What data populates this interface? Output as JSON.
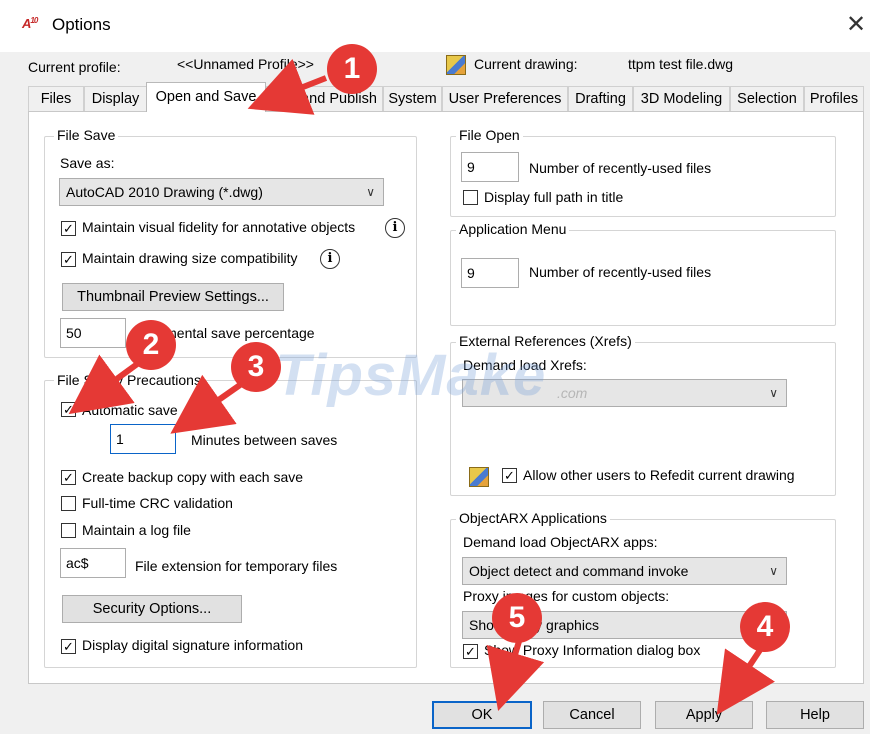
{
  "window": {
    "title": "Options",
    "app_icon": "A",
    "app_icon_sub": "10"
  },
  "profile": {
    "current_profile_label": "Current profile:",
    "current_profile_value": "<<Unnamed Profile>>",
    "current_drawing_label": "Current drawing:",
    "current_drawing_value": "ttpm test file.dwg"
  },
  "tabs": [
    "Files",
    "Display",
    "Open and Save",
    "Plot and Publish",
    "System",
    "User Preferences",
    "Drafting",
    "3D Modeling",
    "Selection",
    "Profiles"
  ],
  "active_tab": "Open and Save",
  "file_save": {
    "title": "File Save",
    "save_as_label": "Save as:",
    "save_as_value": "AutoCAD 2010 Drawing (*.dwg)",
    "fidelity_label": "Maintain visual fidelity for annotative objects",
    "fidelity_checked": true,
    "size_compat_label": "Maintain drawing size compatibility",
    "size_compat_checked": true,
    "thumbnail_button": "Thumbnail Preview Settings...",
    "incremental_value": "50",
    "incremental_label": "Incremental save percentage"
  },
  "file_safety": {
    "title": "File Safety Precautions",
    "autosave_label": "Automatic save",
    "autosave_checked": true,
    "minutes_value": "1",
    "minutes_label": "Minutes between saves",
    "backup_label": "Create backup copy with each save",
    "backup_checked": true,
    "crc_label": "Full-time CRC validation",
    "crc_checked": false,
    "log_label": "Maintain a log file",
    "log_checked": false,
    "ext_value": "ac$",
    "ext_label": "File extension for temporary files",
    "security_button": "Security Options...",
    "signature_label": "Display digital signature information",
    "signature_checked": true
  },
  "file_open": {
    "title": "File Open",
    "recent_value": "9",
    "recent_label": "Number of recently-used files",
    "fullpath_label": "Display full path in title",
    "fullpath_checked": false
  },
  "app_menu": {
    "title": "Application Menu",
    "recent_value": "9",
    "recent_label": "Number of recently-used files"
  },
  "xrefs": {
    "title": "External References (Xrefs)",
    "demand_label": "Demand load Xrefs:",
    "demand_value": "",
    "refedit_label": "Allow other users to Refedit current drawing",
    "refedit_checked": true
  },
  "objectarx": {
    "title": "ObjectARX Applications",
    "demand_label": "Demand load ObjectARX apps:",
    "demand_value": "Object detect and command invoke",
    "proxy_label": "Proxy images for custom objects:",
    "proxy_value": "Show proxy graphics",
    "proxy_dialog_label": "Show Proxy Information dialog box",
    "proxy_dialog_checked": true
  },
  "buttons": {
    "ok": "OK",
    "cancel": "Cancel",
    "apply": "Apply",
    "help": "Help"
  },
  "annotations": [
    "1",
    "2",
    "3",
    "4",
    "5"
  ],
  "watermark": {
    "text": "TipsMake",
    "suffix": ".com"
  },
  "colors": {
    "annotation": "#e53935",
    "focus": "#0a64c8",
    "panel": "#ffffff",
    "dialog": "#f0f0f0"
  }
}
